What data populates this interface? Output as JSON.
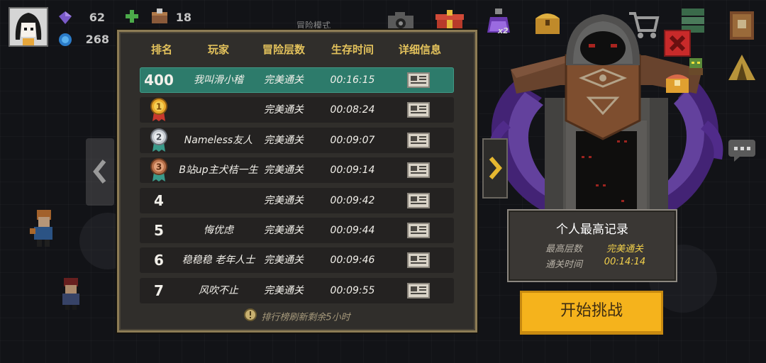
{
  "hud": {
    "gems": "62",
    "items": "18",
    "energy": "268",
    "mode_label": "冒险模式",
    "potion_count": "x2"
  },
  "leaderboard": {
    "headers": [
      "排名",
      "玩家",
      "冒险层数",
      "生存时间",
      "详细信息"
    ],
    "rows": [
      {
        "rank": "400",
        "player": "我叫滑小稽",
        "floor": "完美通关",
        "time": "00:16:15",
        "self": true
      },
      {
        "medal": "1",
        "player": "",
        "floor": "完美通关",
        "time": "00:08:24"
      },
      {
        "medal": "2",
        "player": "Nameless友人",
        "floor": "完美通关",
        "time": "00:09:07"
      },
      {
        "medal": "3",
        "player": "B站up主犬桔一生",
        "floor": "完美通关",
        "time": "00:09:14"
      },
      {
        "rank": "4",
        "player": "",
        "floor": "完美通关",
        "time": "00:09:42"
      },
      {
        "rank": "5",
        "player": "悔优虑",
        "floor": "完美通关",
        "time": "00:09:44"
      },
      {
        "rank": "6",
        "player": "稳稳稳 老年人士",
        "floor": "完美通关",
        "time": "00:09:46"
      },
      {
        "rank": "7",
        "player": "风吹不止",
        "floor": "完美通关",
        "time": "00:09:55"
      }
    ],
    "footer": "排行榜刷新剩余5小时"
  },
  "personal_record": {
    "title": "个人最高记录",
    "rows": [
      {
        "label": "最高层数",
        "value": "完美通关"
      },
      {
        "label": "通关时间",
        "value": "00:14:14"
      }
    ]
  },
  "start_button": {
    "label": "开始挑战"
  },
  "colors": {
    "panel_border": "#8d7c55",
    "header_gold": "#e3c25c",
    "self_row_teal": "#2d7b6b",
    "record_value_yellow": "#f2d04b",
    "start_button": "#f5b31c"
  }
}
